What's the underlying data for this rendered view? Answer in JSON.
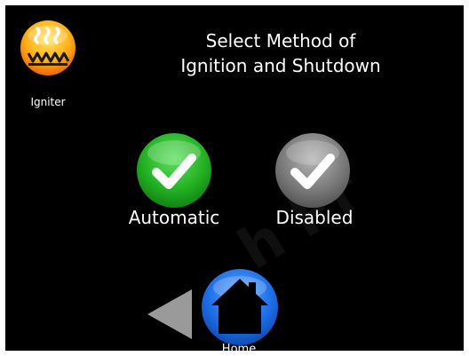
{
  "app": {
    "icon": "igniter-icon",
    "label": "Igniter"
  },
  "title": {
    "line1": "Select Method of",
    "line2": "Ignition and Shutdown"
  },
  "options": [
    {
      "label": "Automatic",
      "icon": "checkmark-icon",
      "color": "#22b022",
      "selected": true
    },
    {
      "label": "Disabled",
      "icon": "checkmark-icon",
      "color": "#7a7a7a",
      "selected": false
    }
  ],
  "nav": {
    "back_icon": "back-arrow-icon",
    "home_label": "Home",
    "home_icon": "home-icon",
    "home_color": "#1e6ee8"
  },
  "watermark": "h Pr"
}
